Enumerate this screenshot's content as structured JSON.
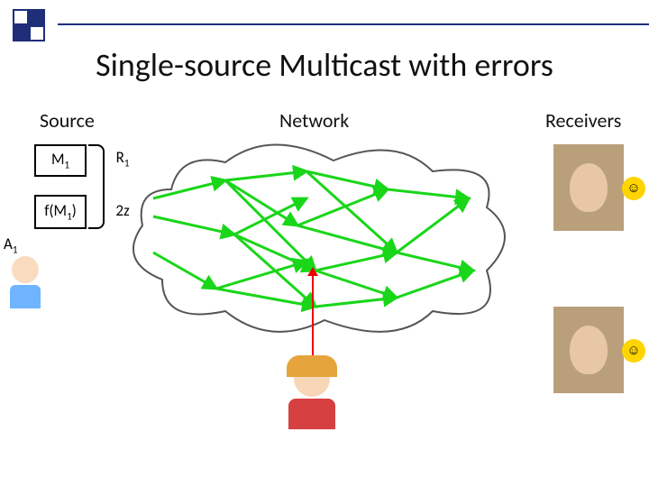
{
  "title": "Single-source Multicast with errors",
  "columns": {
    "source": "Source",
    "network": "Network",
    "receivers": "Receivers"
  },
  "cells": {
    "m1": "M",
    "m1_sub": "1",
    "r1": "R",
    "r1_sub": "1",
    "fm1_pre": "f(M",
    "fm1_sub": "1",
    "fm1_post": ")",
    "zz": "2z"
  },
  "a1": "A",
  "a1_sub": "1",
  "icons": {
    "logo": "slide-deco-icon",
    "cloud": "network-cloud-icon",
    "adversary": "adversary-icon",
    "alice": "source-user-icon",
    "portrait1": "receiver-1-portrait",
    "portrait2": "receiver-2-portrait",
    "smile": "smile-face-icon"
  },
  "colors": {
    "edge": "#19d619",
    "error": "#e00000",
    "frame": "#1f2e79"
  }
}
